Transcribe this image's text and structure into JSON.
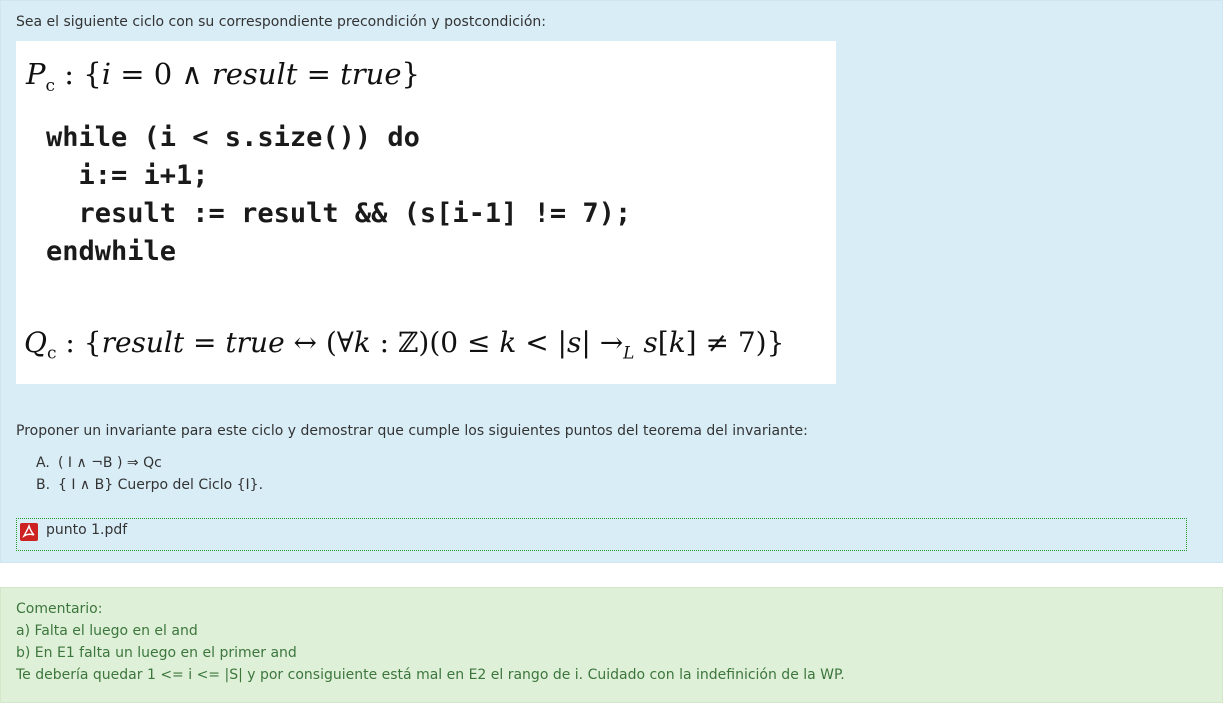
{
  "question": {
    "intro": "Sea el siguiente ciclo con su correspondiente precondición y postcondición:",
    "precondition": {
      "name": "P",
      "sub": "c",
      "text_a": " : {",
      "var_i": "i",
      "text_b": " = 0 ∧ ",
      "var_result": "result",
      "text_c": " = ",
      "var_true": "true",
      "text_d": "}"
    },
    "code_lines": [
      "while (i < s.size()) do",
      "  i:= i+1;",
      "  result := result && (s[i-1] != 7);",
      "endwhile"
    ],
    "postcondition": {
      "name": "Q",
      "sub": "c",
      "text_a": " : {",
      "var_result": "result",
      "text_b": " = ",
      "var_true": "true",
      "text_c": " ↔ (∀",
      "var_k": "k",
      "text_d": " : ℤ)(0 ≤ ",
      "var_k2": "k",
      "text_e": " < |",
      "var_s": "s",
      "text_f": "| →",
      "sub_L": "L",
      "text_g": " ",
      "var_s2": "s",
      "text_h": "[",
      "var_k3": "k",
      "text_i": "] ≠ 7)}"
    },
    "prompt": "Proponer un invariante para este ciclo y demostrar que cumple los siguientes puntos del teorema del invariante:",
    "options": [
      {
        "letter": "A.",
        "text": "( I ∧ ¬B ) ⇒ Qc"
      },
      {
        "letter": "B.",
        "text": "{ I ∧ B} Cuerpo del Ciclo {I}."
      }
    ],
    "attachment": {
      "filename": "punto 1.pdf",
      "icon": "pdf-icon"
    }
  },
  "comment": {
    "title": "Comentario:",
    "lines": [
      "a) Falta el luego en el and",
      "b) En E1 falta un luego en el primer and",
      "Te debería quedar 1 <= i <= |S| y por consiguiente está mal en E2 el rango de i. Cuidado con la indefinición de la WP."
    ]
  },
  "colors": {
    "question_bg": "#d9edf7",
    "comment_bg": "#dff0d8",
    "comment_text": "#3c763d",
    "attachment_border": "#2a9a2a"
  }
}
